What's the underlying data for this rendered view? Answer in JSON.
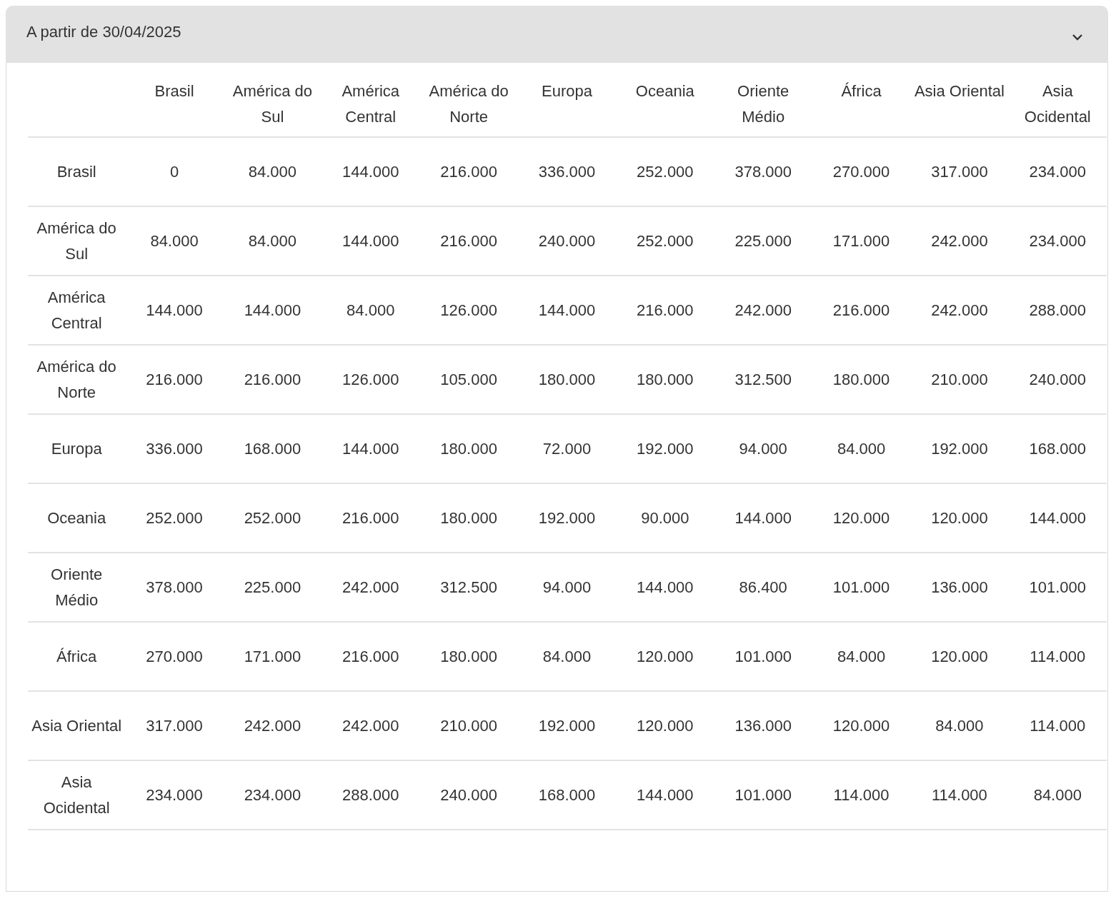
{
  "accordion": {
    "title": "A partir de 30/04/2025",
    "expanded": true
  },
  "table": {
    "columns": [
      "Brasil",
      "América do Sul",
      "América Central",
      "América do Norte",
      "Europa",
      "Oceania",
      "Oriente Médio",
      "África",
      "Asia Oriental",
      "Asia Ocidental"
    ],
    "rows": [
      {
        "label": "Brasil",
        "values": [
          "0",
          "84.000",
          "144.000",
          "216.000",
          "336.000",
          "252.000",
          "378.000",
          "270.000",
          "317.000",
          "234.000"
        ]
      },
      {
        "label": "América do Sul",
        "values": [
          "84.000",
          "84.000",
          "144.000",
          "216.000",
          "240.000",
          "252.000",
          "225.000",
          "171.000",
          "242.000",
          "234.000"
        ]
      },
      {
        "label": "América Central",
        "values": [
          "144.000",
          "144.000",
          "84.000",
          "126.000",
          "144.000",
          "216.000",
          "242.000",
          "216.000",
          "242.000",
          "288.000"
        ]
      },
      {
        "label": "América do Norte",
        "values": [
          "216.000",
          "216.000",
          "126.000",
          "105.000",
          "180.000",
          "180.000",
          "312.500",
          "180.000",
          "210.000",
          "240.000"
        ]
      },
      {
        "label": "Europa",
        "values": [
          "336.000",
          "168.000",
          "144.000",
          "180.000",
          "72.000",
          "192.000",
          "94.000",
          "84.000",
          "192.000",
          "168.000"
        ]
      },
      {
        "label": "Oceania",
        "values": [
          "252.000",
          "252.000",
          "216.000",
          "180.000",
          "192.000",
          "90.000",
          "144.000",
          "120.000",
          "120.000",
          "144.000"
        ]
      },
      {
        "label": "Oriente Médio",
        "values": [
          "378.000",
          "225.000",
          "242.000",
          "312.500",
          "94.000",
          "144.000",
          "86.400",
          "101.000",
          "136.000",
          "101.000"
        ]
      },
      {
        "label": "África",
        "values": [
          "270.000",
          "171.000",
          "216.000",
          "180.000",
          "84.000",
          "120.000",
          "101.000",
          "84.000",
          "120.000",
          "114.000"
        ]
      },
      {
        "label": "Asia Oriental",
        "values": [
          "317.000",
          "242.000",
          "242.000",
          "210.000",
          "192.000",
          "120.000",
          "136.000",
          "120.000",
          "84.000",
          "114.000"
        ]
      },
      {
        "label": "Asia Ocidental",
        "values": [
          "234.000",
          "234.000",
          "288.000",
          "240.000",
          "168.000",
          "144.000",
          "101.000",
          "114.000",
          "114.000",
          "84.000"
        ]
      }
    ]
  }
}
